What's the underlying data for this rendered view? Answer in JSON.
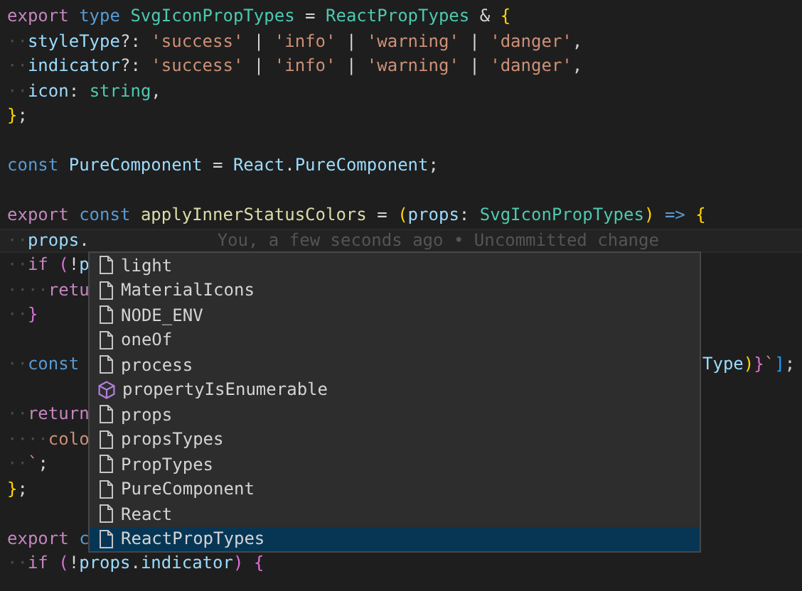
{
  "editor": {
    "lines": [
      {
        "kind": "code",
        "tokens": [
          {
            "t": "export",
            "color": "#c586c0"
          },
          {
            "t": " type",
            "color": "#569cd6"
          },
          {
            "t": " SvgIconPropTypes",
            "color": "#4ec9b0"
          },
          {
            "t": " =",
            "color": "#d4d4d4"
          },
          {
            "t": " ReactPropTypes",
            "color": "#4ec9b0"
          },
          {
            "t": " &",
            "color": "#d4d4d4"
          },
          {
            "t": " {",
            "color": "#ffd700"
          }
        ]
      },
      {
        "kind": "code",
        "tokens": [
          {
            "t": "··",
            "color": "#4a4a4a"
          },
          {
            "t": "styleType",
            "color": "#9cdcfe"
          },
          {
            "t": "?:",
            "color": "#d4d4d4"
          },
          {
            "t": " 'success'",
            "color": "#ce9178"
          },
          {
            "t": " |",
            "color": "#d4d4d4"
          },
          {
            "t": " 'info'",
            "color": "#ce9178"
          },
          {
            "t": " |",
            "color": "#d4d4d4"
          },
          {
            "t": " 'warning'",
            "color": "#ce9178"
          },
          {
            "t": " |",
            "color": "#d4d4d4"
          },
          {
            "t": " 'danger'",
            "color": "#ce9178"
          },
          {
            "t": ",",
            "color": "#d4d4d4"
          }
        ]
      },
      {
        "kind": "code",
        "tokens": [
          {
            "t": "··",
            "color": "#4a4a4a"
          },
          {
            "t": "indicator",
            "color": "#9cdcfe"
          },
          {
            "t": "?:",
            "color": "#d4d4d4"
          },
          {
            "t": " 'success'",
            "color": "#ce9178"
          },
          {
            "t": " |",
            "color": "#d4d4d4"
          },
          {
            "t": " 'info'",
            "color": "#ce9178"
          },
          {
            "t": " |",
            "color": "#d4d4d4"
          },
          {
            "t": " 'warning'",
            "color": "#ce9178"
          },
          {
            "t": " |",
            "color": "#d4d4d4"
          },
          {
            "t": " 'danger'",
            "color": "#ce9178"
          },
          {
            "t": ",",
            "color": "#d4d4d4"
          }
        ]
      },
      {
        "kind": "code",
        "tokens": [
          {
            "t": "··",
            "color": "#4a4a4a"
          },
          {
            "t": "icon",
            "color": "#9cdcfe"
          },
          {
            "t": ":",
            "color": "#d4d4d4"
          },
          {
            "t": " string",
            "color": "#4ec9b0"
          },
          {
            "t": ",",
            "color": "#d4d4d4"
          }
        ]
      },
      {
        "kind": "code",
        "tokens": [
          {
            "t": "}",
            "color": "#ffd700"
          },
          {
            "t": ";",
            "color": "#d4d4d4"
          }
        ]
      },
      {
        "kind": "blank"
      },
      {
        "kind": "code",
        "tokens": [
          {
            "t": "const",
            "color": "#569cd6"
          },
          {
            "t": " PureComponent",
            "color": "#9cdcfe"
          },
          {
            "t": " =",
            "color": "#d4d4d4"
          },
          {
            "t": " React",
            "color": "#9cdcfe"
          },
          {
            "t": ".",
            "color": "#d4d4d4"
          },
          {
            "t": "PureComponent",
            "color": "#9cdcfe"
          },
          {
            "t": ";",
            "color": "#d4d4d4"
          }
        ]
      },
      {
        "kind": "blank"
      },
      {
        "kind": "code",
        "tokens": [
          {
            "t": "export",
            "color": "#c586c0"
          },
          {
            "t": " const",
            "color": "#569cd6"
          },
          {
            "t": " applyInnerStatusColors",
            "color": "#dcdcaa"
          },
          {
            "t": " =",
            "color": "#d4d4d4"
          },
          {
            "t": " (",
            "color": "#ffd700"
          },
          {
            "t": "props",
            "color": "#9cdcfe"
          },
          {
            "t": ":",
            "color": "#d4d4d4"
          },
          {
            "t": " SvgIconPropTypes",
            "color": "#4ec9b0"
          },
          {
            "t": ")",
            "color": "#ffd700"
          },
          {
            "t": " =>",
            "color": "#569cd6"
          },
          {
            "t": " {",
            "color": "#ffd700"
          }
        ]
      },
      {
        "kind": "code",
        "current": true,
        "tokens": [
          {
            "t": "··",
            "color": "#4a4a4a"
          },
          {
            "t": "props",
            "color": "#9cdcfe"
          },
          {
            "t": ".",
            "color": "#d4d4d4"
          }
        ],
        "blame": "You, a few seconds ago • Uncommitted change"
      },
      {
        "kind": "code",
        "tokens": [
          {
            "t": "··",
            "color": "#4a4a4a"
          },
          {
            "t": "if",
            "color": "#c586c0"
          },
          {
            "t": " (",
            "color": "#da70d6"
          },
          {
            "t": "!",
            "color": "#d4d4d4"
          },
          {
            "t": "p",
            "color": "#9cdcfe"
          }
        ]
      },
      {
        "kind": "code",
        "tokens": [
          {
            "t": "····",
            "color": "#4a4a4a"
          },
          {
            "t": "retu",
            "color": "#c586c0"
          }
        ]
      },
      {
        "kind": "code",
        "tokens": [
          {
            "t": "··",
            "color": "#4a4a4a"
          },
          {
            "t": "}",
            "color": "#da70d6"
          }
        ]
      },
      {
        "kind": "blank"
      },
      {
        "kind": "code",
        "tokens": [
          {
            "t": "··",
            "color": "#4a4a4a"
          },
          {
            "t": "const",
            "color": "#569cd6"
          }
        ],
        "tail": [
          {
            "t": "Type",
            "color": "#9cdcfe"
          },
          {
            "t": ")",
            "color": "#ffd700"
          },
          {
            "t": "}",
            "color": "#da70d6"
          },
          {
            "t": "`",
            "color": "#ce9178"
          },
          {
            "t": "]",
            "color": "#179fff"
          },
          {
            "t": ";",
            "color": "#d4d4d4"
          }
        ]
      },
      {
        "kind": "blank"
      },
      {
        "kind": "code",
        "tokens": [
          {
            "t": "··",
            "color": "#4a4a4a"
          },
          {
            "t": "return",
            "color": "#c586c0"
          }
        ]
      },
      {
        "kind": "code",
        "tokens": [
          {
            "t": "····",
            "color": "#4a4a4a"
          },
          {
            "t": "colo",
            "color": "#ce9178"
          }
        ]
      },
      {
        "kind": "code",
        "tokens": [
          {
            "t": "··",
            "color": "#4a4a4a"
          },
          {
            "t": "`",
            "color": "#ce9178"
          },
          {
            "t": ";",
            "color": "#d4d4d4"
          }
        ]
      },
      {
        "kind": "code",
        "tokens": [
          {
            "t": "}",
            "color": "#ffd700"
          },
          {
            "t": ";",
            "color": "#d4d4d4"
          }
        ]
      },
      {
        "kind": "blank"
      },
      {
        "kind": "code",
        "tokens": [
          {
            "t": "export",
            "color": "#c586c0"
          },
          {
            "t": " c",
            "color": "#569cd6"
          }
        ]
      },
      {
        "kind": "code",
        "tokens": [
          {
            "t": "··",
            "color": "#4a4a4a"
          },
          {
            "t": "if",
            "color": "#c586c0"
          },
          {
            "t": " (",
            "color": "#da70d6"
          },
          {
            "t": "!",
            "color": "#d4d4d4"
          },
          {
            "t": "props",
            "color": "#9cdcfe"
          },
          {
            "t": ".",
            "color": "#d4d4d4"
          },
          {
            "t": "indicator",
            "color": "#9cdcfe"
          },
          {
            "t": ")",
            "color": "#da70d6"
          },
          {
            "t": " {",
            "color": "#da70d6"
          }
        ]
      }
    ]
  },
  "suggestions": [
    {
      "label": "light",
      "kind": "text",
      "selected": false
    },
    {
      "label": "MaterialIcons",
      "kind": "text",
      "selected": false
    },
    {
      "label": "NODE_ENV",
      "kind": "text",
      "selected": false
    },
    {
      "label": "oneOf",
      "kind": "text",
      "selected": false
    },
    {
      "label": "process",
      "kind": "text",
      "selected": false
    },
    {
      "label": "propertyIsEnumerable",
      "kind": "method",
      "selected": false
    },
    {
      "label": "props",
      "kind": "text",
      "selected": false
    },
    {
      "label": "propsTypes",
      "kind": "text",
      "selected": false
    },
    {
      "label": "PropTypes",
      "kind": "text",
      "selected": false
    },
    {
      "label": "PureComponent",
      "kind": "text",
      "selected": false
    },
    {
      "label": "React",
      "kind": "text",
      "selected": false
    },
    {
      "label": "ReactPropTypes",
      "kind": "text",
      "selected": true
    }
  ]
}
